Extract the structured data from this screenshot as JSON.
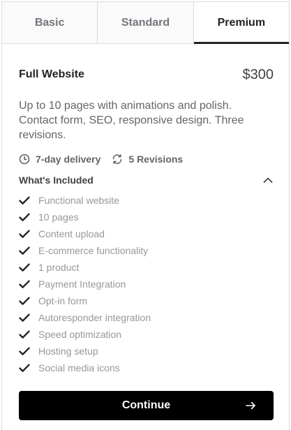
{
  "tabs": [
    {
      "label": "Basic",
      "active": false
    },
    {
      "label": "Standard",
      "active": false
    },
    {
      "label": "Premium",
      "active": true
    }
  ],
  "package": {
    "title": "Full Website",
    "price": "$300",
    "description": "Up to 10 pages with animations and polish. Contact form, SEO, responsive design. Three revisions.",
    "delivery": {
      "icon": "clock-icon",
      "label": "7-day delivery"
    },
    "revisions": {
      "icon": "refresh-icon",
      "label": "5 Revisions"
    }
  },
  "included": {
    "title": "What's Included",
    "expanded": true,
    "toggle_icon": "chevron-up-icon",
    "features": [
      "Functional website",
      "10 pages",
      "Content upload",
      "E-commerce functionality",
      "1 product",
      "Payment Integration",
      "Opt-in form",
      "Autoresponder integration",
      "Speed optimization",
      "Hosting setup",
      "Social media icons"
    ]
  },
  "cta": {
    "label": "Continue",
    "icon": "arrow-right-icon"
  },
  "colors": {
    "accent": "#000000",
    "active_tab_underline": "#222325",
    "muted_text": "#95979d"
  }
}
